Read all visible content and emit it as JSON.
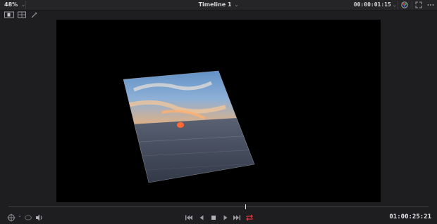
{
  "top_bar": {
    "zoom_level": "48%",
    "timeline_name": "Timeline 1",
    "timecode": "00:00:01:15"
  },
  "icons": {
    "zoom_dropdown": "chevron-down-icon",
    "timeline_dropdown": "chevron-down-icon",
    "timecode_dropdown": "chevron-down-icon",
    "color_viewer": "color-wheel-icon",
    "fullscreen": "expand-icon",
    "more_options": "ellipsis-icon",
    "transform_overlay": "transform-icon",
    "onscreen_controls": "onscreen-controls-icon",
    "magic_wand": "magic-wand-icon",
    "dropdown": "chevron-down-icon",
    "audio": "speaker-icon",
    "first_frame": "skip-to-start-icon",
    "play_reverse": "play-reverse-icon",
    "stop": "stop-icon",
    "play": "play-icon",
    "last_frame": "skip-to-end-icon",
    "loop": "loop-icon"
  },
  "colors": {
    "loop_active": "#e0343a",
    "background": "#1e1e21",
    "viewer": "#000000"
  },
  "transport": {
    "timecode": "01:00:25:21",
    "loop_enabled": true
  },
  "viewer": {
    "content": "sunset-over-ocean-image"
  }
}
